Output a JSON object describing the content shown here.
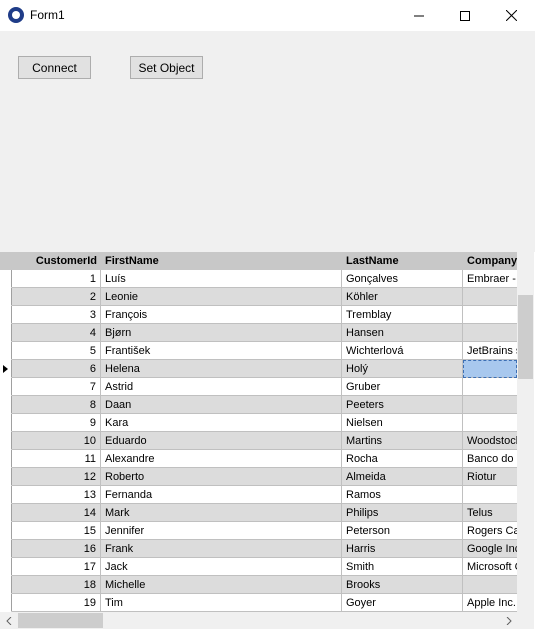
{
  "window": {
    "title": "Form1"
  },
  "toolbar": {
    "connect_label": "Connect",
    "set_object_label": "Set Object"
  },
  "grid": {
    "columns": [
      "CustomerId",
      "FirstName",
      "LastName",
      "Company"
    ],
    "rows": [
      {
        "id": "1",
        "first": "Luís",
        "last": "Gonçalves",
        "company": "Embraer - "
      },
      {
        "id": "2",
        "first": "Leonie",
        "last": "Köhler",
        "company": ""
      },
      {
        "id": "3",
        "first": "François",
        "last": "Tremblay",
        "company": ""
      },
      {
        "id": "4",
        "first": "Bjørn",
        "last": "Hansen",
        "company": ""
      },
      {
        "id": "5",
        "first": "František",
        "last": "Wichterlová",
        "company": "JetBrains s"
      },
      {
        "id": "6",
        "first": "Helena",
        "last": "Holý",
        "company": ""
      },
      {
        "id": "7",
        "first": "Astrid",
        "last": "Gruber",
        "company": ""
      },
      {
        "id": "8",
        "first": "Daan",
        "last": "Peeters",
        "company": ""
      },
      {
        "id": "9",
        "first": "Kara",
        "last": "Nielsen",
        "company": ""
      },
      {
        "id": "10",
        "first": "Eduardo",
        "last": "Martins",
        "company": "Woodstock"
      },
      {
        "id": "11",
        "first": "Alexandre",
        "last": "Rocha",
        "company": "Banco do B"
      },
      {
        "id": "12",
        "first": "Roberto",
        "last": "Almeida",
        "company": "Riotur"
      },
      {
        "id": "13",
        "first": "Fernanda",
        "last": "Ramos",
        "company": ""
      },
      {
        "id": "14",
        "first": "Mark",
        "last": "Philips",
        "company": "Telus"
      },
      {
        "id": "15",
        "first": "Jennifer",
        "last": "Peterson",
        "company": "Rogers Ca"
      },
      {
        "id": "16",
        "first": "Frank",
        "last": "Harris",
        "company": "Google Inc"
      },
      {
        "id": "17",
        "first": "Jack",
        "last": "Smith",
        "company": "Microsoft C"
      },
      {
        "id": "18",
        "first": "Michelle",
        "last": "Brooks",
        "company": ""
      },
      {
        "id": "19",
        "first": "Tim",
        "last": "Goyer",
        "company": "Apple Inc."
      }
    ],
    "current_row_index": 5,
    "selected_column": "Company"
  },
  "icons": {
    "app": "app-icon",
    "minimize": "minimize-icon",
    "maximize": "maximize-icon",
    "close": "close-icon",
    "row_indicator": "current-row-arrow-icon",
    "scroll_left": "scroll-left-arrow-icon",
    "scroll_right": "scroll-right-arrow-icon"
  },
  "colors": {
    "header_bg": "#c8c8c8",
    "alt_row_bg": "#dcdcdc",
    "selection_bg": "#a8c8ee"
  }
}
